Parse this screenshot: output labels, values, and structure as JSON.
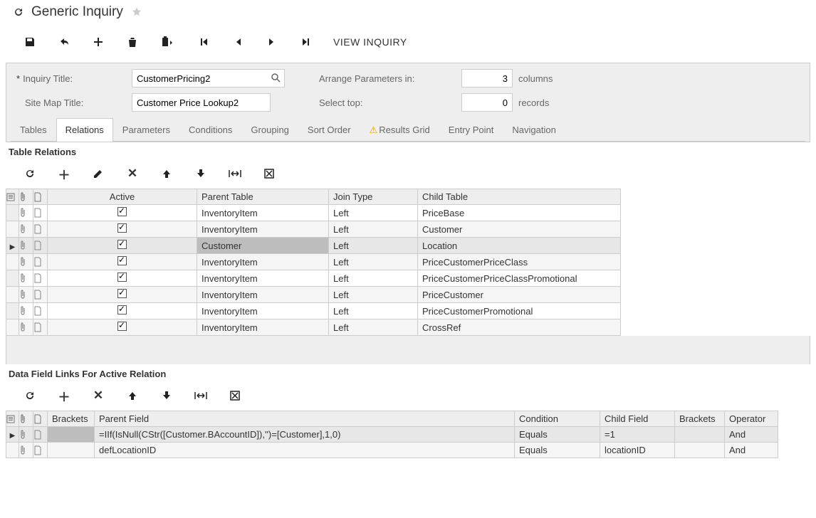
{
  "page": {
    "title": "Generic Inquiry"
  },
  "toolbar": {
    "view_inquiry": "VIEW INQUIRY"
  },
  "form": {
    "inquiry_title_label": "Inquiry Title:",
    "inquiry_title_value": "CustomerPricing2",
    "site_map_label": "Site Map Title:",
    "site_map_value": "Customer Price Lookup2",
    "arrange_label": "Arrange Parameters in:",
    "arrange_value": "3",
    "arrange_unit": "columns",
    "select_top_label": "Select top:",
    "select_top_value": "0",
    "select_top_unit": "records"
  },
  "tabs": [
    "Tables",
    "Relations",
    "Parameters",
    "Conditions",
    "Grouping",
    "Sort Order",
    "Results Grid",
    "Entry Point",
    "Navigation"
  ],
  "tabs_active_index": 1,
  "tabs_warn_index": 6,
  "relations": {
    "section_title": "Table Relations",
    "columns": {
      "active": "Active",
      "parent": "Parent Table",
      "join": "Join Type",
      "child": "Child Table"
    },
    "rows": [
      {
        "active": true,
        "parent": "InventoryItem",
        "join": "Left",
        "child": "PriceBase"
      },
      {
        "active": true,
        "parent": "InventoryItem",
        "join": "Left",
        "child": "Customer"
      },
      {
        "active": true,
        "parent": "Customer",
        "join": "Left",
        "child": "Location",
        "selected": true
      },
      {
        "active": true,
        "parent": "InventoryItem",
        "join": "Left",
        "child": "PriceCustomerPriceClass"
      },
      {
        "active": true,
        "parent": "InventoryItem",
        "join": "Left",
        "child": "PriceCustomerPriceClassPromotional"
      },
      {
        "active": true,
        "parent": "InventoryItem",
        "join": "Left",
        "child": "PriceCustomer"
      },
      {
        "active": true,
        "parent": "InventoryItem",
        "join": "Left",
        "child": "PriceCustomerPromotional"
      },
      {
        "active": true,
        "parent": "InventoryItem",
        "join": "Left",
        "child": "CrossRef"
      }
    ]
  },
  "links": {
    "section_title": "Data Field Links For Active Relation",
    "columns": {
      "brackets1": "Brackets",
      "parent_field": "Parent Field",
      "condition": "Condition",
      "child_field": "Child Field",
      "brackets2": "Brackets",
      "operator": "Operator"
    },
    "rows": [
      {
        "brackets1": "",
        "parent_field": "=IIf(IsNull(CStr([Customer.BAccountID]),'')=[Customer],1,0)",
        "condition": "Equals",
        "child_field": "=1",
        "brackets2": "",
        "operator": "And",
        "selected": true
      },
      {
        "brackets1": "",
        "parent_field": "defLocationID",
        "condition": "Equals",
        "child_field": "locationID",
        "brackets2": "",
        "operator": "And"
      }
    ]
  }
}
